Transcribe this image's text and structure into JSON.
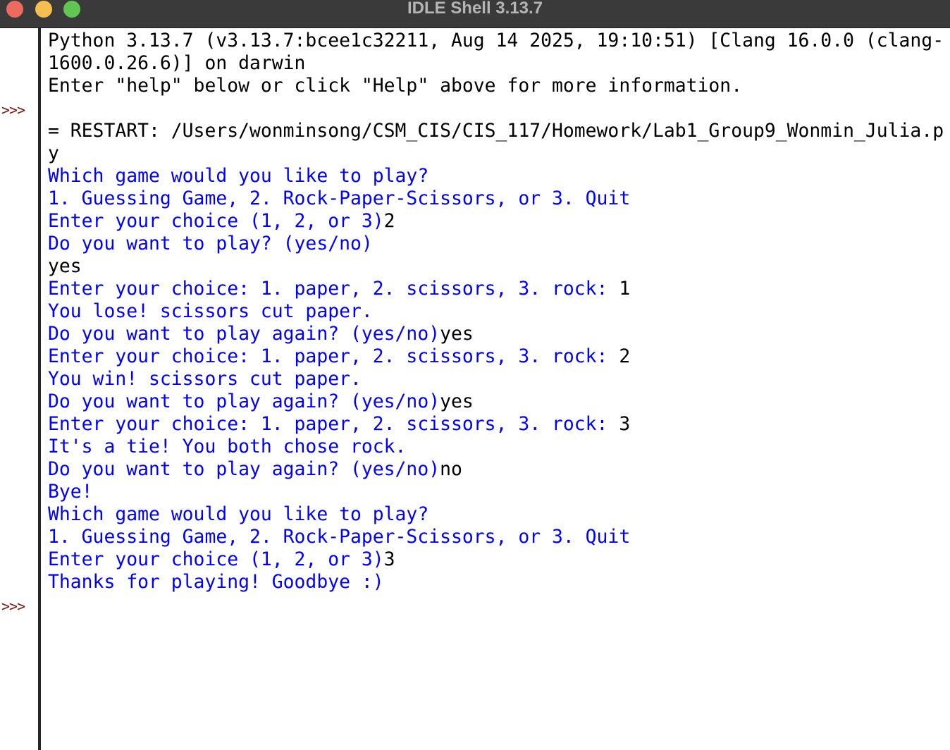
{
  "window": {
    "title": "IDLE Shell 3.13.7"
  },
  "gutter": {
    "prompts": [
      ">>>",
      ">>>"
    ]
  },
  "shell": {
    "lines": [
      {
        "segments": [
          {
            "kind": "plain",
            "text": "Python 3.13.7 (v3.13.7:bcee1c32211, Aug 14 2025, 19:10:51) [Clang 16.0.0 (clang-"
          }
        ]
      },
      {
        "segments": [
          {
            "kind": "plain",
            "text": "1600.0.26.6)] on darwin"
          }
        ]
      },
      {
        "segments": [
          {
            "kind": "plain",
            "text": "Enter \"help\" below or click \"Help\" above for more information."
          }
        ]
      },
      {
        "segments": [
          {
            "kind": "plain",
            "text": ""
          }
        ]
      },
      {
        "segments": [
          {
            "kind": "plain",
            "text": "= RESTART: /Users/wonminsong/CSM_CIS/CIS_117/Homework/Lab1_Group9_Wonmin_Julia.p"
          }
        ]
      },
      {
        "segments": [
          {
            "kind": "plain",
            "text": "y"
          }
        ]
      },
      {
        "segments": [
          {
            "kind": "out",
            "text": "Which game would you like to play?"
          }
        ]
      },
      {
        "segments": [
          {
            "kind": "out",
            "text": "1. Guessing Game, 2. Rock-Paper-Scissors, or 3. Quit"
          }
        ]
      },
      {
        "segments": [
          {
            "kind": "out",
            "text": "Enter your choice (1, 2, or 3)"
          },
          {
            "kind": "in",
            "text": "2"
          }
        ]
      },
      {
        "segments": [
          {
            "kind": "out",
            "text": "Do you want to play? (yes/no)"
          }
        ]
      },
      {
        "segments": [
          {
            "kind": "in",
            "text": "yes"
          }
        ]
      },
      {
        "segments": [
          {
            "kind": "out",
            "text": "Enter your choice: 1. paper, 2. scissors, 3. rock: "
          },
          {
            "kind": "in",
            "text": "1"
          }
        ]
      },
      {
        "segments": [
          {
            "kind": "out",
            "text": "You lose! scissors cut paper."
          }
        ]
      },
      {
        "segments": [
          {
            "kind": "out",
            "text": "Do you want to play again? (yes/no)"
          },
          {
            "kind": "in",
            "text": "yes"
          }
        ]
      },
      {
        "segments": [
          {
            "kind": "out",
            "text": "Enter your choice: 1. paper, 2. scissors, 3. rock: "
          },
          {
            "kind": "in",
            "text": "2"
          }
        ]
      },
      {
        "segments": [
          {
            "kind": "out",
            "text": "You win! scissors cut paper."
          }
        ]
      },
      {
        "segments": [
          {
            "kind": "out",
            "text": "Do you want to play again? (yes/no)"
          },
          {
            "kind": "in",
            "text": "yes"
          }
        ]
      },
      {
        "segments": [
          {
            "kind": "out",
            "text": "Enter your choice: 1. paper, 2. scissors, 3. rock: "
          },
          {
            "kind": "in",
            "text": "3"
          }
        ]
      },
      {
        "segments": [
          {
            "kind": "out",
            "text": "It's a tie! You both chose rock."
          }
        ]
      },
      {
        "segments": [
          {
            "kind": "out",
            "text": "Do you want to play again? (yes/no)"
          },
          {
            "kind": "in",
            "text": "no"
          }
        ]
      },
      {
        "segments": [
          {
            "kind": "out",
            "text": "Bye!"
          }
        ]
      },
      {
        "segments": [
          {
            "kind": "out",
            "text": "Which game would you like to play?"
          }
        ]
      },
      {
        "segments": [
          {
            "kind": "out",
            "text": "1. Guessing Game, 2. Rock-Paper-Scissors, or 3. Quit"
          }
        ]
      },
      {
        "segments": [
          {
            "kind": "out",
            "text": "Enter your choice (1, 2, or 3)"
          },
          {
            "kind": "in",
            "text": "3"
          }
        ]
      },
      {
        "segments": [
          {
            "kind": "out",
            "text": "Thanks for playing! Goodbye :)"
          }
        ]
      },
      {
        "segments": [
          {
            "kind": "plain",
            "text": ""
          }
        ]
      }
    ]
  },
  "colors": {
    "titlebar": "#3a3a3a",
    "title_text": "#b5b5b5",
    "close": "#ed6a5e",
    "minimize": "#f5bf4f",
    "zoom": "#61c554",
    "stdout": "#0000ff",
    "stdin": "#000000",
    "prompt": "#7a1515"
  }
}
